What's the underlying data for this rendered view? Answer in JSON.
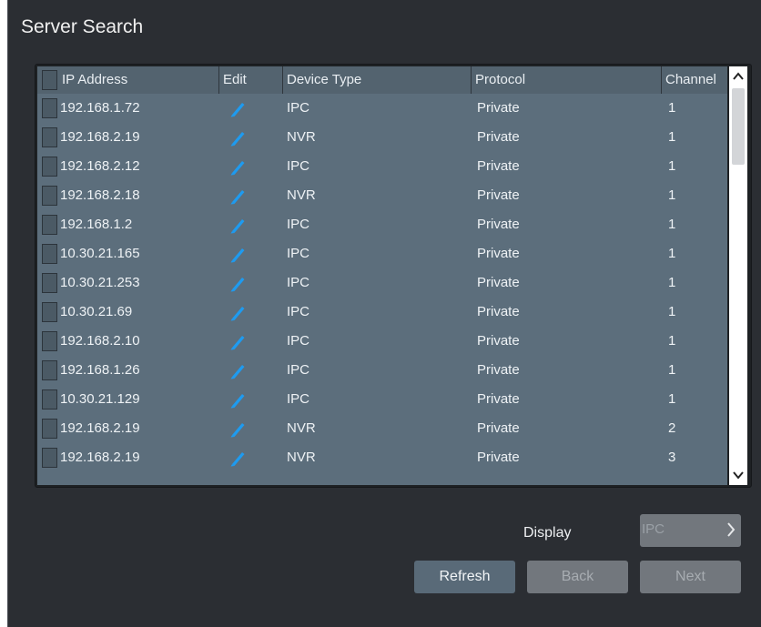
{
  "window": {
    "title": "Server Search"
  },
  "table": {
    "columns": [
      "IP Address",
      "Edit",
      "Device Type",
      "Protocol",
      "Channel"
    ],
    "rows": [
      {
        "ip": "192.168.1.72",
        "type": "IPC",
        "protocol": "Private",
        "channel": "1"
      },
      {
        "ip": "192.168.2.19",
        "type": "NVR",
        "protocol": "Private",
        "channel": "1"
      },
      {
        "ip": "192.168.2.12",
        "type": "IPC",
        "protocol": "Private",
        "channel": "1"
      },
      {
        "ip": "192.168.2.18",
        "type": "NVR",
        "protocol": "Private",
        "channel": "1"
      },
      {
        "ip": "192.168.1.2",
        "type": "IPC",
        "protocol": "Private",
        "channel": "1"
      },
      {
        "ip": "10.30.21.165",
        "type": "IPC",
        "protocol": "Private",
        "channel": "1"
      },
      {
        "ip": "10.30.21.253",
        "type": "IPC",
        "protocol": "Private",
        "channel": "1"
      },
      {
        "ip": "10.30.21.69",
        "type": "IPC",
        "protocol": "Private",
        "channel": "1"
      },
      {
        "ip": "192.168.2.10",
        "type": "IPC",
        "protocol": "Private",
        "channel": "1"
      },
      {
        "ip": "192.168.1.26",
        "type": "IPC",
        "protocol": "Private",
        "channel": "1"
      },
      {
        "ip": "10.30.21.129",
        "type": "IPC",
        "protocol": "Private",
        "channel": "1"
      },
      {
        "ip": "192.168.2.19",
        "type": "NVR",
        "protocol": "Private",
        "channel": "2"
      },
      {
        "ip": "192.168.2.19",
        "type": "NVR",
        "protocol": "Private",
        "channel": "3"
      }
    ],
    "edit_icon": "pencil-icon",
    "edit_icon_color": "#1e9bf0"
  },
  "footer": {
    "display_label": "Display",
    "display_value": "IPC",
    "refresh_label": "Refresh",
    "back_label": "Back",
    "next_label": "Next"
  }
}
